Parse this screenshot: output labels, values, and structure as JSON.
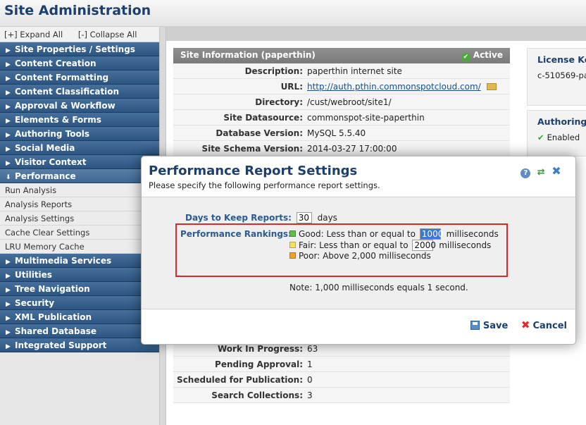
{
  "header": {
    "title": "Site Administration"
  },
  "sidebar": {
    "expand_all": "[+] Expand All",
    "collapse_all": "[-] Collapse All",
    "items_top": [
      "Site Properties / Settings",
      "Content Creation",
      "Content Formatting",
      "Content Classification",
      "Approval & Workflow",
      "Elements & Forms",
      "Authoring Tools",
      "Social Media",
      "Visitor Context"
    ],
    "performance": {
      "label": "Performance",
      "children": [
        "Run Analysis",
        "Analysis Reports",
        "Analysis Settings",
        "Cache Clear Settings",
        "LRU Memory Cache"
      ]
    },
    "items_bottom": [
      "Multimedia Services",
      "Utilities",
      "Tree Navigation",
      "Security",
      "XML Publication",
      "Shared Database",
      "Integrated Support"
    ]
  },
  "site_info": {
    "heading": "Site Information (paperthin)",
    "status": "Active",
    "rows": [
      {
        "label": "Description:",
        "value": "paperthin internet site"
      },
      {
        "label": "URL:",
        "value": "http://auth.pthin.commonspotcloud.com/"
      },
      {
        "label": "Directory:",
        "value": "/cust/webroot/site1/"
      },
      {
        "label": "Site Datasource:",
        "value": "commonspot-site-paperthin"
      },
      {
        "label": "Database Version:",
        "value": "MySQL 5.5.40"
      },
      {
        "label": "Site Schema Version:",
        "value": "2014-03-27 17:00:00"
      }
    ],
    "lower_rows": [
      {
        "label": "Work In Progress:",
        "value": "63"
      },
      {
        "label": "Pending Approval:",
        "value": "1"
      },
      {
        "label": "Scheduled for Publication:",
        "value": "0"
      },
      {
        "label": "Search Collections:",
        "value": "3"
      }
    ]
  },
  "license": {
    "heading": "License Ke",
    "value": "c-510569-pa"
  },
  "authoring": {
    "heading": "Authoring S",
    "value": "Enabled"
  },
  "modal": {
    "title": "Performance Report Settings",
    "subtitle": "Please specify the following performance report settings.",
    "days_label": "Days to Keep Reports:",
    "days_value": "30",
    "days_unit": "days",
    "rankings_label": "Performance Rankings:",
    "good_text": "Good: Less than or equal to",
    "good_value": "1000",
    "fair_text": "Fair: Less than or equal to",
    "fair_value": "2000",
    "ms_unit": "milliseconds",
    "poor_text": "Poor: Above 2,000 milliseconds",
    "note": "Note: 1,000 milliseconds equals 1 second.",
    "save_label": "Save",
    "cancel_label": "Cancel",
    "colors": {
      "good": "#5cbf4a",
      "fair": "#f3e25a",
      "poor": "#f1a02b",
      "highlight": "#e0262b"
    }
  }
}
